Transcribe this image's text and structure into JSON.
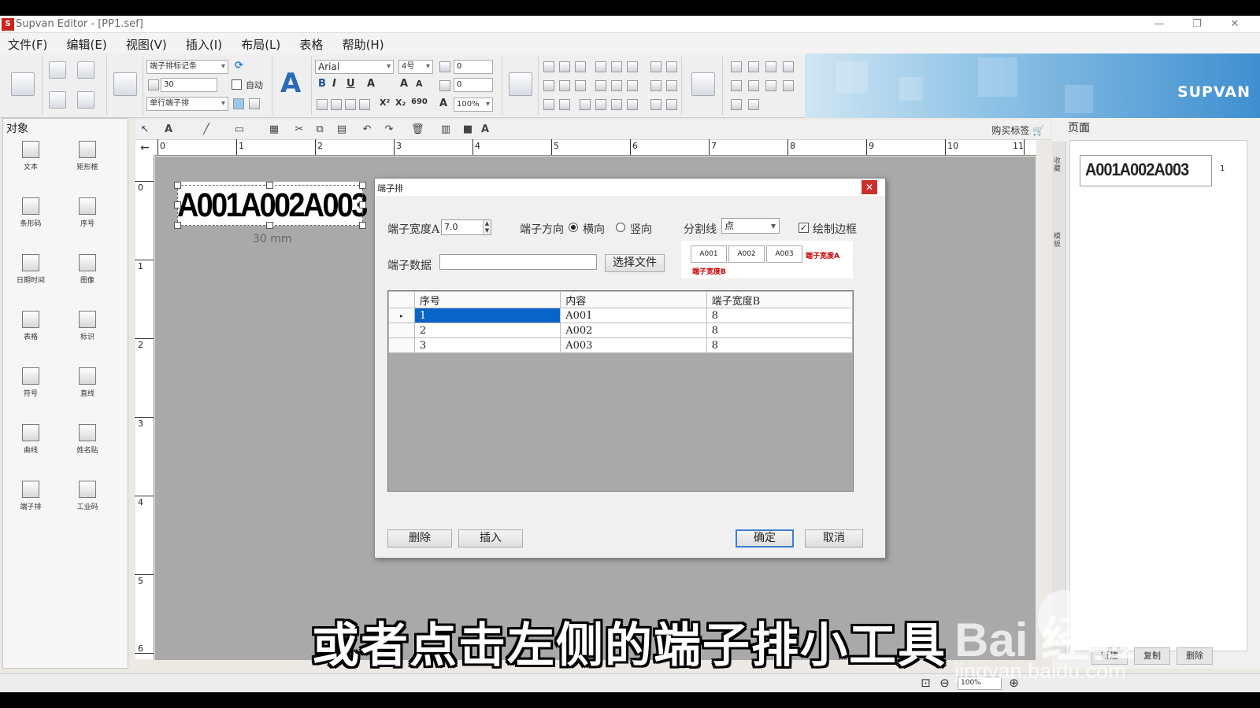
{
  "window": {
    "app_logo": "S",
    "title": "Supvan Editor - [PP1.sef]",
    "minimize": "—",
    "restore": "❐",
    "close": "✕"
  },
  "menu": [
    {
      "label": "文件(F)"
    },
    {
      "label": "编辑(E)"
    },
    {
      "label": "视图(V)"
    },
    {
      "label": "插入(I)"
    },
    {
      "label": "布局(L)"
    },
    {
      "label": "表格"
    },
    {
      "label": "帮助(H)"
    }
  ],
  "toolbar": {
    "label_type": "端子排标记条",
    "length_value": "30",
    "auto_label": "自动",
    "row_type": "单行端子排",
    "font_name": "Arial",
    "font_size": "4号",
    "spacing_a": "0",
    "spacing_b": "0",
    "zoom_small": "100%",
    "bold": "B",
    "italic": "I",
    "underline": "U",
    "brand": "SUPVAN"
  },
  "objects_panel": {
    "title": "对象",
    "tools": [
      {
        "label": "文本",
        "icon": "text-tool-icon"
      },
      {
        "label": "矩形框",
        "icon": "rectangle-tool-icon"
      },
      {
        "label": "条形码",
        "icon": "barcode-tool-icon"
      },
      {
        "label": "序号",
        "icon": "serial-tool-icon"
      },
      {
        "label": "日期时间",
        "icon": "datetime-tool-icon"
      },
      {
        "label": "图像",
        "icon": "image-tool-icon"
      },
      {
        "label": "表格",
        "icon": "table-tool-icon"
      },
      {
        "label": "标识",
        "icon": "warning-sign-tool-icon"
      },
      {
        "label": "符号",
        "icon": "symbol-tool-icon"
      },
      {
        "label": "直线",
        "icon": "line-tool-icon"
      },
      {
        "label": "曲线",
        "icon": "curve-tool-icon"
      },
      {
        "label": "姓名贴",
        "icon": "name-tag-tool-icon"
      },
      {
        "label": "端子排",
        "icon": "terminal-block-tool-icon"
      },
      {
        "label": "工业码",
        "icon": "industrial-code-tool-icon"
      }
    ]
  },
  "drawbar": {
    "buy_label": "购买标签"
  },
  "ruler": {
    "h_numbers": [
      "0",
      "1",
      "2",
      "3",
      "4",
      "5",
      "6",
      "7",
      "8",
      "9",
      "10",
      "11"
    ],
    "v_numbers": [
      "0",
      "1",
      "2",
      "3",
      "4",
      "5",
      "6"
    ]
  },
  "canvas": {
    "label_text": "A001A002A003",
    "dimension": "30 mm"
  },
  "page_panel": {
    "title": "页面",
    "side_tabs": [
      "收藏",
      "模板"
    ],
    "thumb_text": "A001A002A003",
    "thumb_number": "1",
    "buttons": [
      {
        "label": "新建"
      },
      {
        "label": "复制"
      },
      {
        "label": "删除"
      }
    ]
  },
  "statusbar": {
    "zoom": "100%"
  },
  "dialog": {
    "title": "端子排",
    "close": "✕",
    "width_label": "端子宽度A",
    "width_value": "7.0",
    "direction_label": "端子方向",
    "horizontal": "横向",
    "vertical": "竖向",
    "divider_label": "分割线",
    "divider_value": "点",
    "border_label": "绘制边框",
    "data_label": "端子数据",
    "data_value": "",
    "choose_file": "选择文件",
    "preview": {
      "cells": [
        "A001",
        "A002",
        "A003"
      ],
      "width_a_note": "端子宽度A",
      "width_b_note": "端子宽度B"
    },
    "table": {
      "headers": [
        "序号",
        "内容",
        "端子宽度B"
      ],
      "rows": [
        {
          "indicator": "▸",
          "no": "1",
          "content": "A001",
          "width_b": "8"
        },
        {
          "indicator": "",
          "no": "2",
          "content": "A002",
          "width_b": "8"
        },
        {
          "indicator": "",
          "no": "3",
          "content": "A003",
          "width_b": "8"
        }
      ]
    },
    "delete_button": "删除",
    "insert_button": "插入",
    "ok_button": "确定",
    "cancel_button": "取消"
  },
  "overlay": {
    "subtitle": "或者点击左侧的端子排小工具",
    "watermark": "Bai 经验",
    "watermark_url": "jingyan.baidu.com"
  }
}
